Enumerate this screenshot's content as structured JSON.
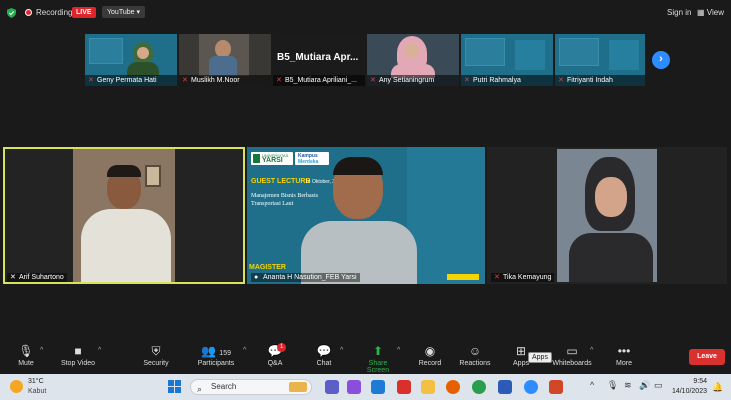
{
  "topbar": {
    "recording_label": "Recording",
    "live_label": "LIVE",
    "stream_target": "YouTube",
    "sign_in": "Sign in",
    "view_label": "View"
  },
  "gallery_strip": [
    {
      "name": "Geny Permata Hati"
    },
    {
      "name": "Muslikh M.Noor"
    },
    {
      "name": "B5_Mutiara Apriliani_...",
      "video_text": "B5_Mutiara  Apr..."
    },
    {
      "name": "Any Setianingrum"
    },
    {
      "name": "Putri Rahmalya"
    },
    {
      "name": "Fitriyanti Indah"
    }
  ],
  "main_tiles": [
    {
      "name": "Arif Suhartono"
    },
    {
      "name": "Ananta H Nasution_FEB Yarsi",
      "slide": {
        "university": "UNIVERSITAS",
        "brand": "YARSI",
        "kampus": "Kampus",
        "merdeka": "Merdeka",
        "event": "GUEST LECTURE",
        "date": "14 Oktober, 2023",
        "topic_line1": "Manajemen Bisnis Berbasis",
        "topic_line2": "Transportasi Laut",
        "footer": "MAGISTER"
      }
    },
    {
      "name": "Tika Kemayung"
    }
  ],
  "toolbar": {
    "mute": "Mute",
    "stop_video": "Stop Video",
    "security": "Security",
    "participants": "Participants",
    "participants_count": "159",
    "qa": "Q&A",
    "qa_badge": "1",
    "chat": "Chat",
    "share_screen": "Share Screen",
    "record": "Record",
    "reactions": "Reactions",
    "apps": "Apps",
    "apps_tooltip": "Apps",
    "whiteboards": "Whiteboards",
    "more": "More",
    "leave": "Leave"
  },
  "taskbar": {
    "temperature": "31°C",
    "condition": "Kabut",
    "search_placeholder": "Search",
    "time": "9:54",
    "date": "14/10/2023"
  },
  "colors": {
    "accent_blue": "#2d8cff",
    "leave_red": "#d8312f",
    "live_red": "#e0242b",
    "active_speaker": "#d8e35a",
    "slide_teal": "#1f6f8b",
    "share_green": "#2bb24c"
  }
}
